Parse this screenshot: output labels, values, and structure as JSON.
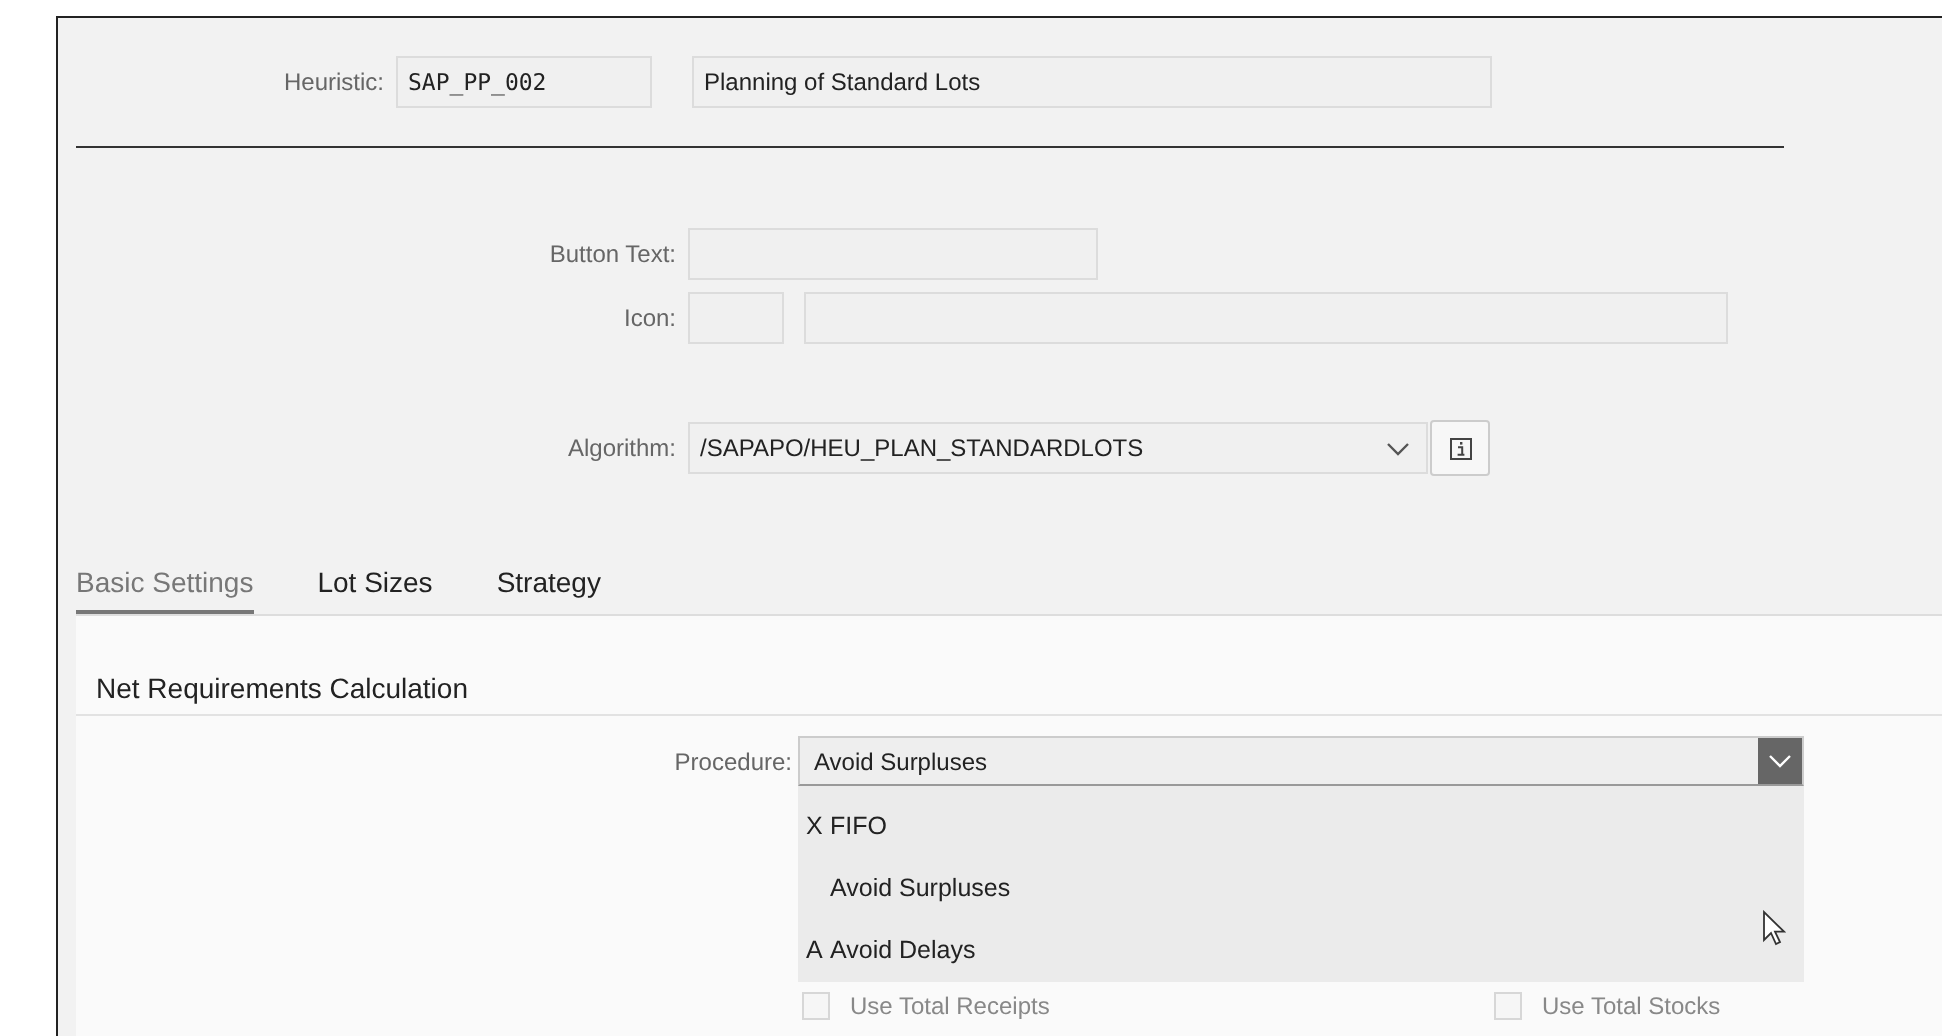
{
  "heuristic": {
    "label": "Heuristic:",
    "code": "SAP_PP_002",
    "description": "Planning of Standard Lots"
  },
  "button_text": {
    "label": "Button Text:"
  },
  "icon": {
    "label": "Icon:"
  },
  "algorithm": {
    "label": "Algorithm:",
    "value": "/SAPAPO/HEU_PLAN_STANDARDLOTS"
  },
  "tabs": [
    {
      "label": "Basic Settings",
      "selected": true
    },
    {
      "label": "Lot Sizes",
      "selected": false
    },
    {
      "label": "Strategy",
      "selected": false
    }
  ],
  "section_title": "Net Requirements Calculation",
  "procedure": {
    "label": "Procedure:",
    "value": "Avoid Surpluses",
    "expanded": true,
    "options": [
      {
        "key": "X",
        "text": "FIFO"
      },
      {
        "text": "Avoid Surpluses"
      },
      {
        "key": "A",
        "text": "Avoid Delays"
      }
    ]
  },
  "checkboxes": [
    {
      "label": "Use Total Receipts",
      "checked": false,
      "disabled": true
    },
    {
      "label": "Use Total Stocks",
      "checked": false,
      "disabled": true
    }
  ]
}
